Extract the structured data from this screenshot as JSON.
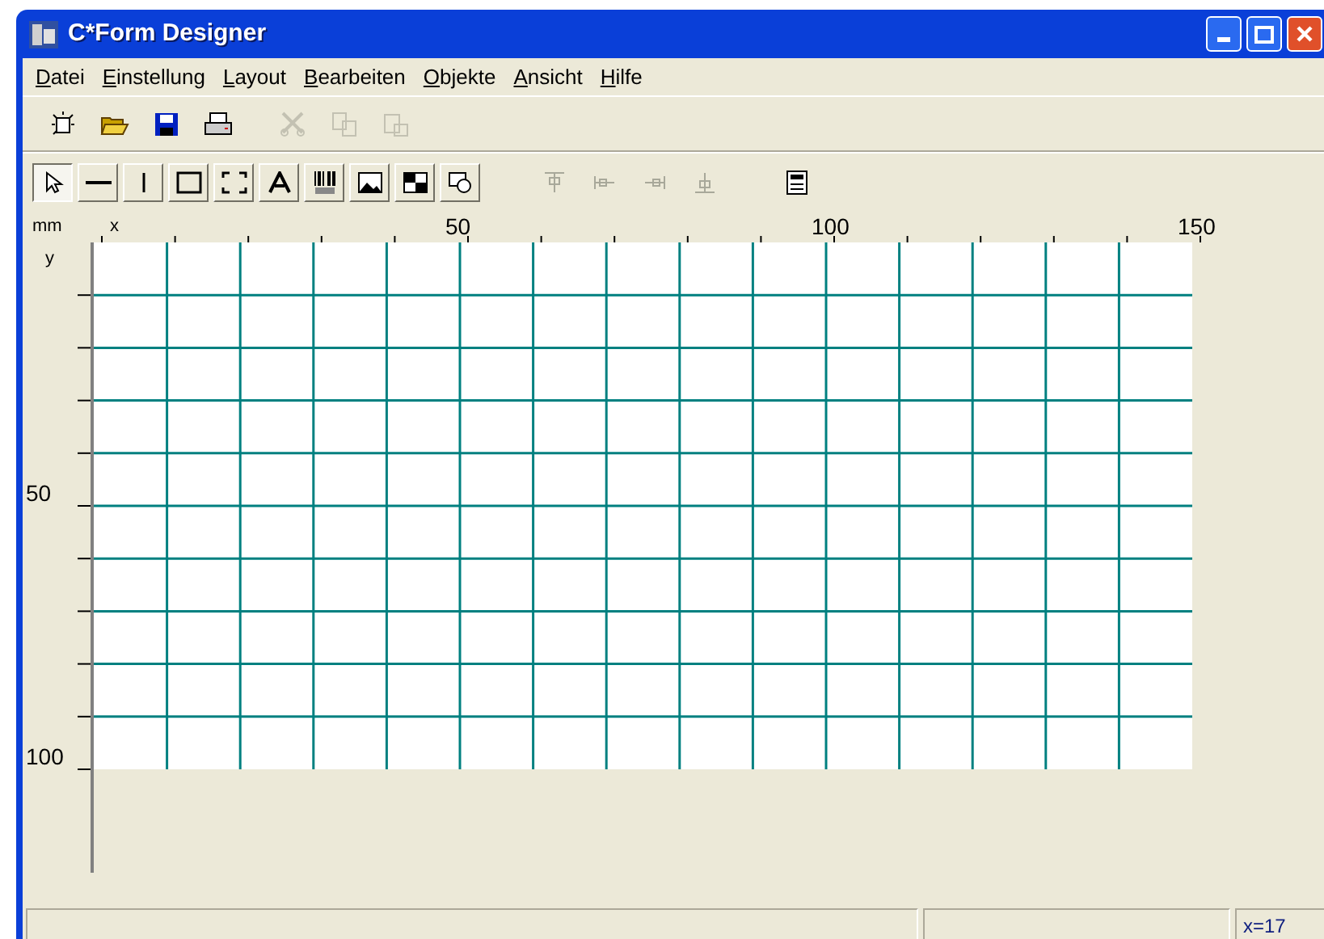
{
  "window": {
    "title": "C*Form Designer"
  },
  "menu": [
    "Datei",
    "Einstellung",
    "Layout",
    "Bearbeiten",
    "Objekte",
    "Ansicht",
    "Hilfe"
  ],
  "toolbar": [
    {
      "disabled": false
    },
    {
      "disabled": false
    },
    {
      "disabled": false
    },
    {
      "disabled": false
    },
    {
      "disabled": true
    },
    {
      "disabled": true
    },
    {
      "disabled": true
    }
  ],
  "tools": [
    {
      "selected": true
    },
    {
      "selected": false
    },
    {
      "selected": false
    },
    {
      "selected": false
    },
    {
      "selected": false
    },
    {
      "selected": false
    },
    {
      "selected": false
    },
    {
      "selected": false
    },
    {
      "selected": false
    },
    {
      "selected": false
    }
  ],
  "align_tools": [
    {
      "disabled": true
    },
    {
      "disabled": true
    },
    {
      "disabled": true
    },
    {
      "disabled": true
    },
    {
      "disabled": false
    }
  ],
  "ruler": {
    "unit": "mm",
    "x_label": "x",
    "y_label": "y",
    "x_marks": [
      "50",
      "100",
      "150"
    ],
    "y_marks": [
      "50",
      "100"
    ]
  },
  "status_bar": {
    "coordinates": "x=17"
  }
}
